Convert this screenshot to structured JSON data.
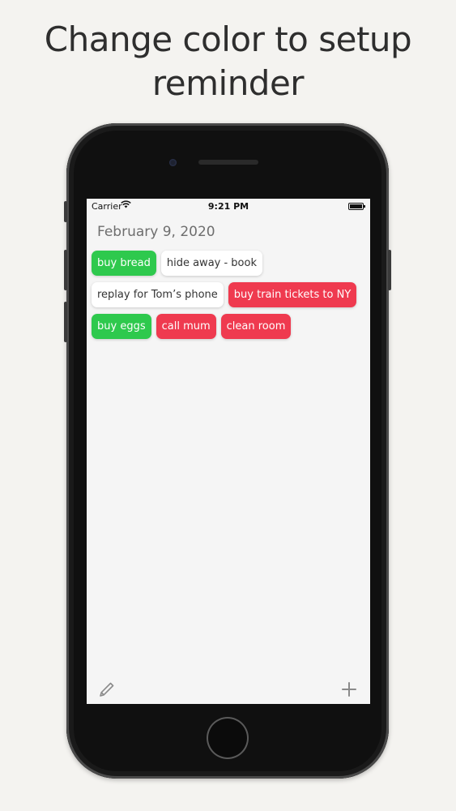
{
  "headline": {
    "line1": "Change color to setup",
    "line2": "reminder"
  },
  "status_bar": {
    "carrier": "Carrier",
    "time": "9:21 PM",
    "icons": [
      "wifi-icon",
      "battery-icon"
    ]
  },
  "app": {
    "date": "February 9, 2020",
    "tag_rows": [
      [
        {
          "label": "buy bread",
          "color": "green"
        },
        {
          "label": "hide away - book",
          "color": "white"
        }
      ],
      [
        {
          "label": "replay for Tom’s phone",
          "color": "white"
        },
        {
          "label": "buy train tickets to NY",
          "color": "red"
        }
      ],
      [
        {
          "label": "buy eggs",
          "color": "green"
        },
        {
          "label": "call mum",
          "color": "red"
        },
        {
          "label": "clean room",
          "color": "red"
        }
      ]
    ],
    "toolbar": {
      "left_icon": "pencil-icon",
      "right_icon": "plus-icon"
    }
  },
  "colors": {
    "green": "#2ec94d",
    "red": "#ef3a4f",
    "white": "#ffffff"
  }
}
